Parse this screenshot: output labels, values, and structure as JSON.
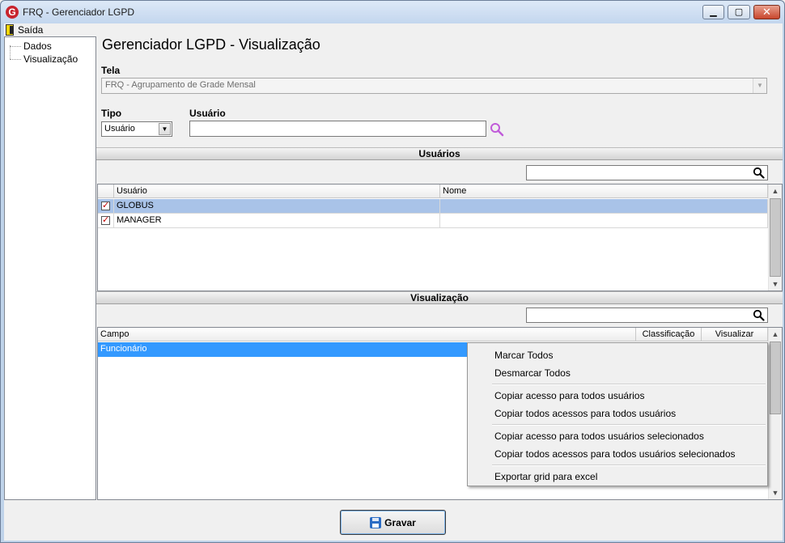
{
  "window": {
    "title": "FRQ - Gerenciador LGPD",
    "app_icon_letter": "G",
    "minimize_glyph": "▁",
    "maximize_glyph": "▢",
    "close_glyph": "✕"
  },
  "menu": {
    "exit_label": "Saída"
  },
  "tree": {
    "items": [
      "Dados",
      "Visualização"
    ]
  },
  "header": {
    "title": "Gerenciador LGPD - Visualização"
  },
  "form": {
    "tela_label": "Tela",
    "tela_value": "FRQ - Agrupamento de Grade Mensal",
    "tipo_label": "Tipo",
    "tipo_value": "Usuário",
    "usuario_label": "Usuário",
    "usuario_value": ""
  },
  "users_section": {
    "title": "Usuários",
    "search_value": "",
    "columns": [
      "Usuário",
      "Nome"
    ],
    "rows": [
      {
        "checked": true,
        "usuario": "GLOBUS",
        "nome": "",
        "selected": true
      },
      {
        "checked": true,
        "usuario": "MANAGER",
        "nome": "",
        "selected": false
      }
    ]
  },
  "view_section": {
    "title": "Visualização",
    "search_value": "",
    "columns": [
      "Campo",
      "Classificação",
      "Visualizar"
    ],
    "rows": [
      {
        "campo": "Funcionário",
        "selected": true
      }
    ]
  },
  "context_menu": {
    "items": [
      "Marcar Todos",
      "Desmarcar Todos",
      "Copiar acesso para todos usuários",
      "Copiar todos acessos para todos usuários",
      "Copiar acesso para todos usuários selecionados",
      "Copiar todos acessos para todos usuários selecionados",
      "Exportar grid para excel"
    ]
  },
  "footer": {
    "save_label": "Gravar"
  },
  "icons": {
    "app": "app-logo-icon",
    "exit": "door-exit-icon",
    "search_user": "magnifier-icon",
    "save": "floppy-disk-icon"
  },
  "colors": {
    "selection_blue": "#3399ff",
    "row_selected": "#a9c3e8",
    "search_icon_purple": "#c05bd9",
    "checkbox_red": "#c00000"
  }
}
